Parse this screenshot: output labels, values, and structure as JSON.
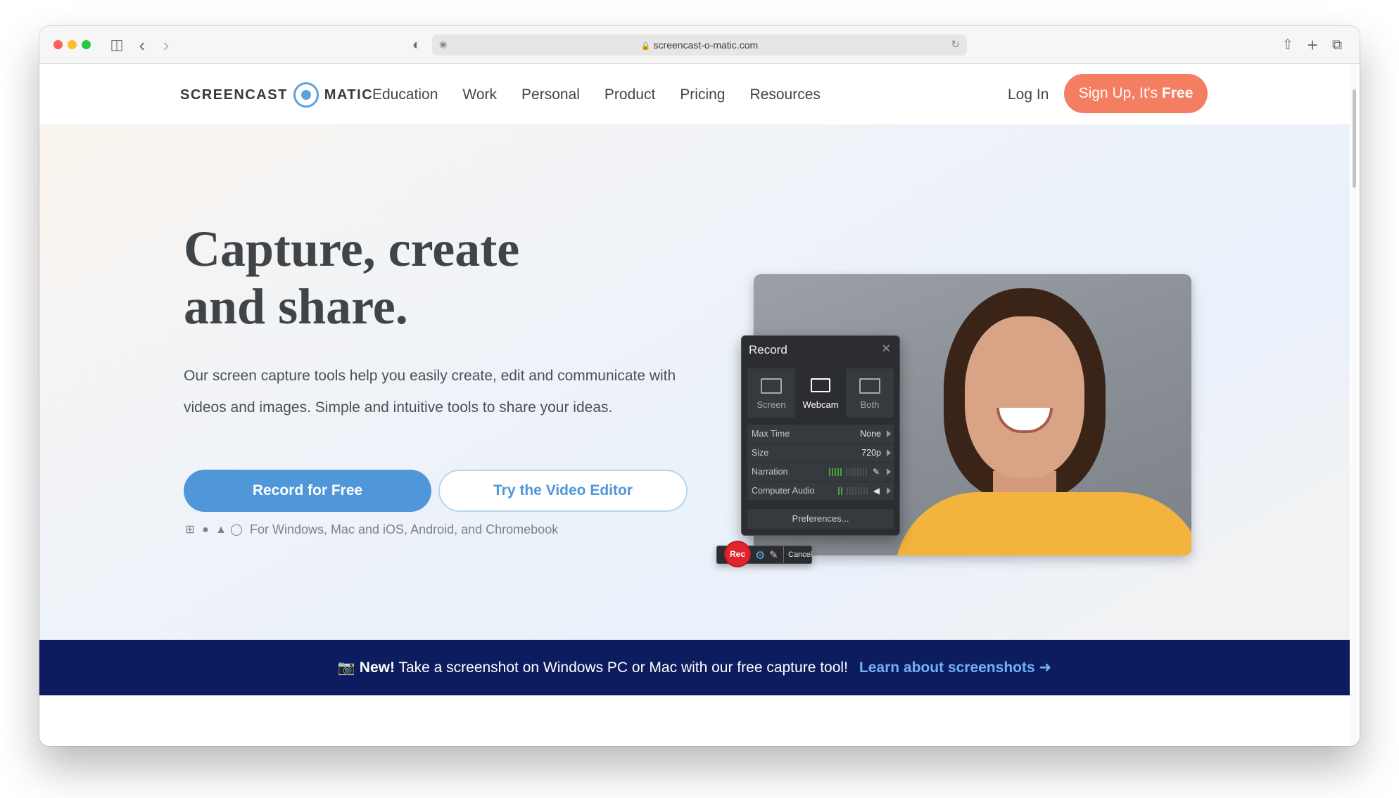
{
  "browser": {
    "url": "screencast-o-matic.com",
    "icons": [
      "sidebar-icon",
      "back-icon",
      "forward-icon",
      "shield-icon",
      "lock-icon",
      "reload-icon",
      "share-icon",
      "new-tab-icon",
      "tabs-overview-icon"
    ]
  },
  "header": {
    "logo_left": "SCREENCAST",
    "logo_right": "MATIC",
    "nav": [
      "Education",
      "Work",
      "Personal",
      "Product",
      "Pricing",
      "Resources"
    ],
    "login": "Log In",
    "signup": "Sign Up, It's ",
    "signup_bold": "Free"
  },
  "hero": {
    "title": "Capture, create and share.",
    "description": "Our screen capture tools help you easily create, edit and communicate with videos and images. Simple and intuitive tools to share your ideas.",
    "primary_button": "Record for Free",
    "secondary_button": "Try the Video Editor",
    "platforms_text": "For Windows, Mac and iOS, Android, and Chromebook"
  },
  "recorder": {
    "title": "Record",
    "modes": [
      "Screen",
      "Webcam",
      "Both"
    ],
    "active_mode": "Webcam",
    "rows": [
      {
        "label": "Max Time",
        "value": "None"
      },
      {
        "label": "Size",
        "value": "720p"
      },
      {
        "label": "Narration",
        "value": ""
      },
      {
        "label": "Computer Audio",
        "value": ""
      }
    ],
    "preferences": "Preferences...",
    "rec_label": "Rec",
    "cancel_label": "Cancel"
  },
  "banner": {
    "new_label": "New!",
    "text": " Take a screenshot on Windows PC or Mac with our free capture tool!",
    "link": "Learn about screenshots"
  },
  "colors": {
    "accent_blue": "#4f97d9",
    "signup_orange": "#f47e62",
    "banner_navy": "#0d1c5e",
    "link_blue": "#6fb1f3"
  }
}
